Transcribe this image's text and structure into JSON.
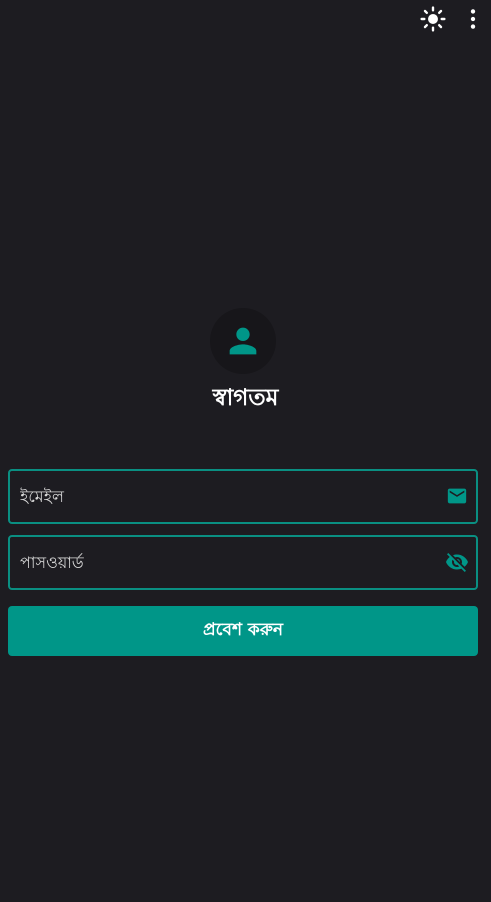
{
  "app_bar": {
    "theme_icon": "sun-icon",
    "menu_icon": "more-vertical-icon"
  },
  "profile": {
    "icon": "person-icon",
    "welcome_text": "স্বাগতম"
  },
  "form": {
    "email": {
      "placeholder": "ইমেইল",
      "value": "",
      "icon": "mail-icon"
    },
    "password": {
      "placeholder": "পাসওয়ার্ড",
      "value": "",
      "icon": "visibility-off-icon"
    },
    "submit_label": "প্রবেশ করুন"
  },
  "colors": {
    "background": "#1d1c21",
    "accent": "#009688",
    "field_border": "#0a8f82",
    "avatar_bg": "#17161a"
  }
}
